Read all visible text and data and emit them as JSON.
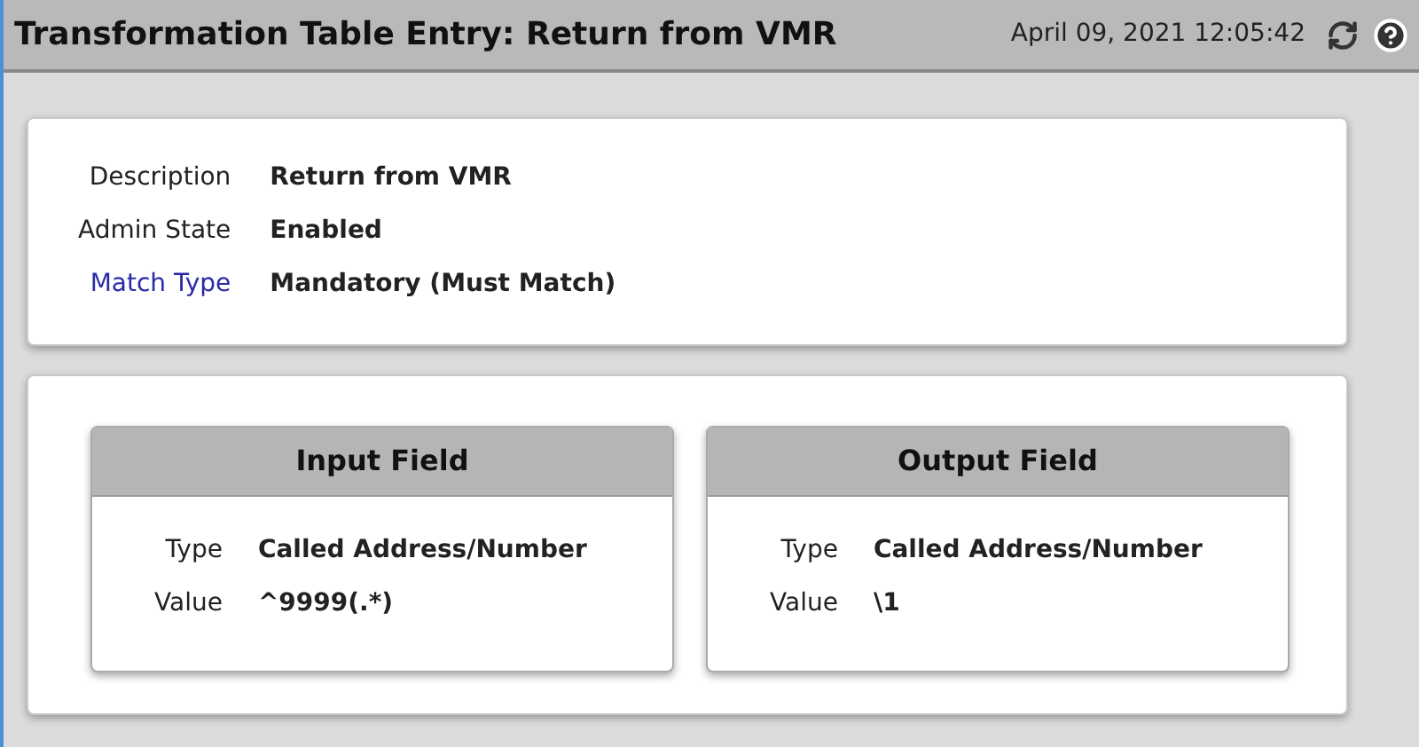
{
  "header": {
    "title": "Transformation Table Entry: Return from VMR",
    "timestamp": "April 09, 2021 12:05:42"
  },
  "summary": [
    {
      "label": "Description",
      "value": "Return from VMR",
      "kind": "text"
    },
    {
      "label": "Admin State",
      "value": "Enabled",
      "kind": "text"
    },
    {
      "label": "Match Type",
      "value": "Mandatory (Must Match)",
      "kind": "link"
    }
  ],
  "fields": [
    {
      "title": "Input Field",
      "rows": [
        {
          "label": "Type",
          "value": "Called Address/Number"
        },
        {
          "label": "Value",
          "value": "^9999(.*)"
        }
      ]
    },
    {
      "title": "Output Field",
      "rows": [
        {
          "label": "Type",
          "value": "Called Address/Number"
        },
        {
          "label": "Value",
          "value": "\\1"
        }
      ]
    }
  ]
}
